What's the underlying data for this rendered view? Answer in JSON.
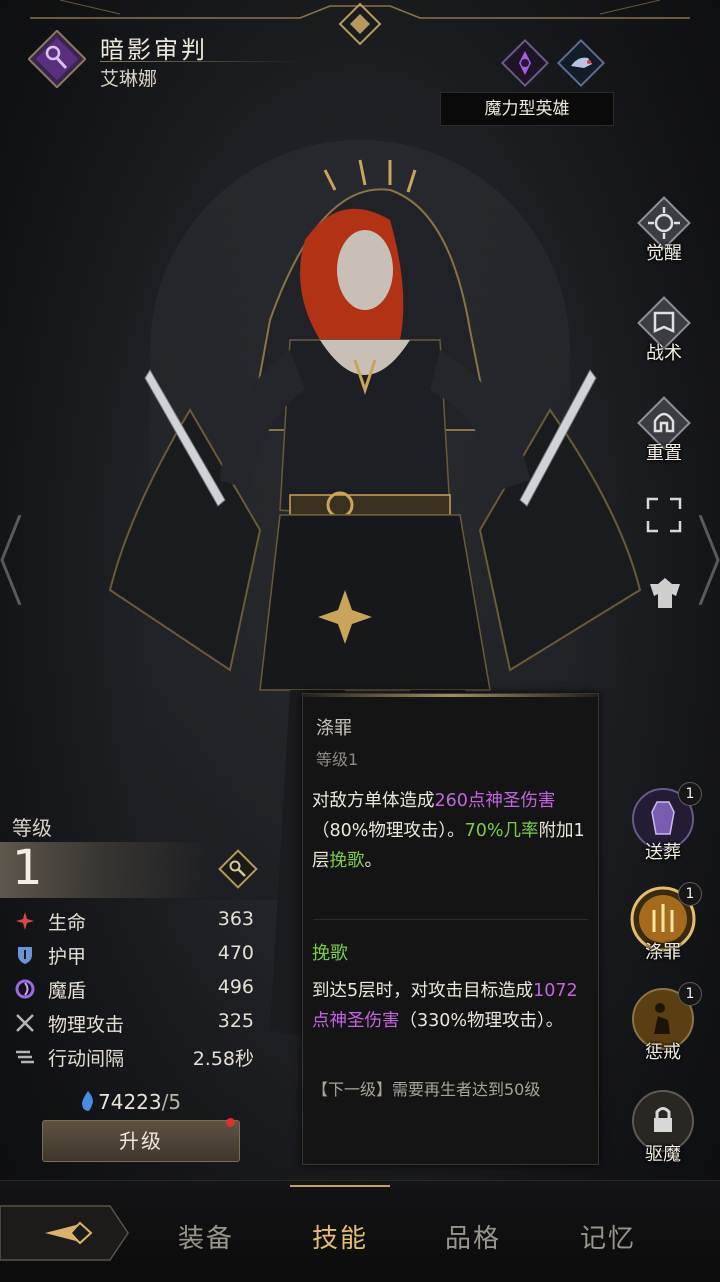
{
  "header": {
    "hero_title": "暗影审判",
    "hero_name": "艾琳娜",
    "hero_type": "魔力型英雄"
  },
  "side_menu": {
    "awaken": "觉醒",
    "tactics": "战术",
    "reset": "重置"
  },
  "stats": {
    "level_label": "等级",
    "level_value": "1",
    "rows": [
      {
        "name": "生命",
        "value": "363",
        "icon": "heart-icon"
      },
      {
        "name": "护甲",
        "value": "470",
        "icon": "shield-icon"
      },
      {
        "name": "魔盾",
        "value": "496",
        "icon": "magic-shield-icon"
      },
      {
        "name": "物理攻击",
        "value": "325",
        "icon": "crossed-swords-icon"
      },
      {
        "name": "行动间隔",
        "value": "2.58秒",
        "icon": "speed-icon"
      }
    ],
    "soul_amount": "74223",
    "soul_max": "/5",
    "upgrade_label": "升级"
  },
  "skill_tooltip": {
    "title": "涤罪",
    "level": "等级1",
    "desc_1": "对敌方单体造成",
    "desc_2": "260点神圣伤害",
    "desc_3": "（80%物理攻击）。",
    "desc_4": "70%几率",
    "desc_5": "附加1层",
    "desc_6": "挽歌",
    "desc_7": "。",
    "sub_title": "挽歌",
    "sub_1": "到达5层时，对攻击目标造成",
    "sub_2": "1072点神圣伤害",
    "sub_3": "（330%物理攻击）。",
    "next_level": "【下一级】需要再生者达到50级"
  },
  "skills": [
    {
      "label": "送葬",
      "badge": "1"
    },
    {
      "label": "涤罪",
      "badge": "1"
    },
    {
      "label": "惩戒",
      "badge": "1"
    },
    {
      "label": "驱魔"
    }
  ],
  "bottom_tabs": {
    "equipment": "装备",
    "skills": "技能",
    "quality": "品格",
    "memory": "记忆"
  },
  "colors": {
    "accent_gold": "#e3be6e",
    "purple_text": "#c463e2",
    "green_text": "#7ccd45"
  }
}
